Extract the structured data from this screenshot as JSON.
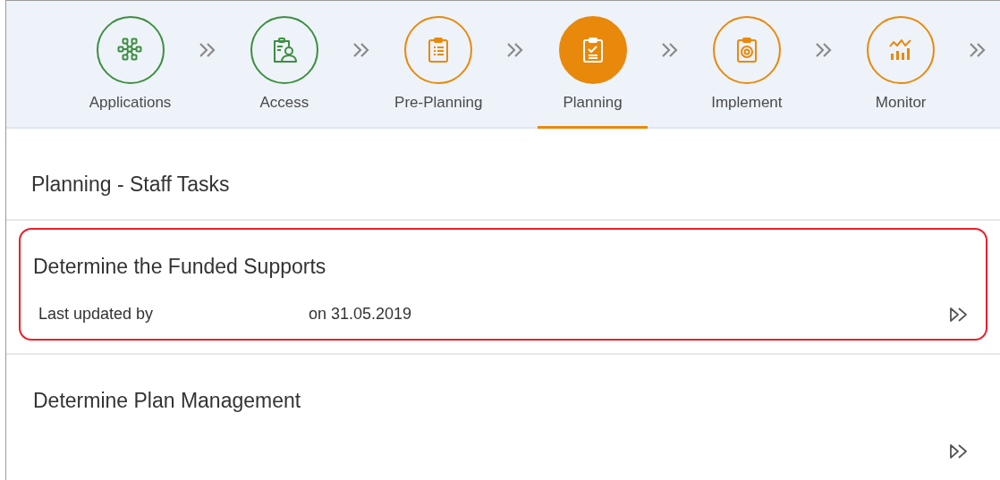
{
  "steps": [
    {
      "label": "Applications",
      "kind": "network",
      "color": "#3e8e41",
      "selected": false
    },
    {
      "label": "Access",
      "kind": "person-clipboard",
      "color": "#3e8e41",
      "selected": false
    },
    {
      "label": "Pre-Planning",
      "kind": "list-clipboard",
      "color": "#e8890c",
      "selected": false
    },
    {
      "label": "Planning",
      "kind": "check-clipboard",
      "color": "#e8890c",
      "selected": true
    },
    {
      "label": "Implement",
      "kind": "target-clipboard",
      "color": "#e8890c",
      "selected": false
    },
    {
      "label": "Monitor",
      "kind": "chart",
      "color": "#e8890c",
      "selected": false
    }
  ],
  "section": {
    "title": "Planning - Staff Tasks"
  },
  "tasks": [
    {
      "title": "Determine the Funded Supports",
      "updated_label": "Last updated by",
      "updated_date": "on 31.05.2019",
      "highlighted": true
    },
    {
      "title": "Determine Plan Management",
      "highlighted": false
    }
  ]
}
